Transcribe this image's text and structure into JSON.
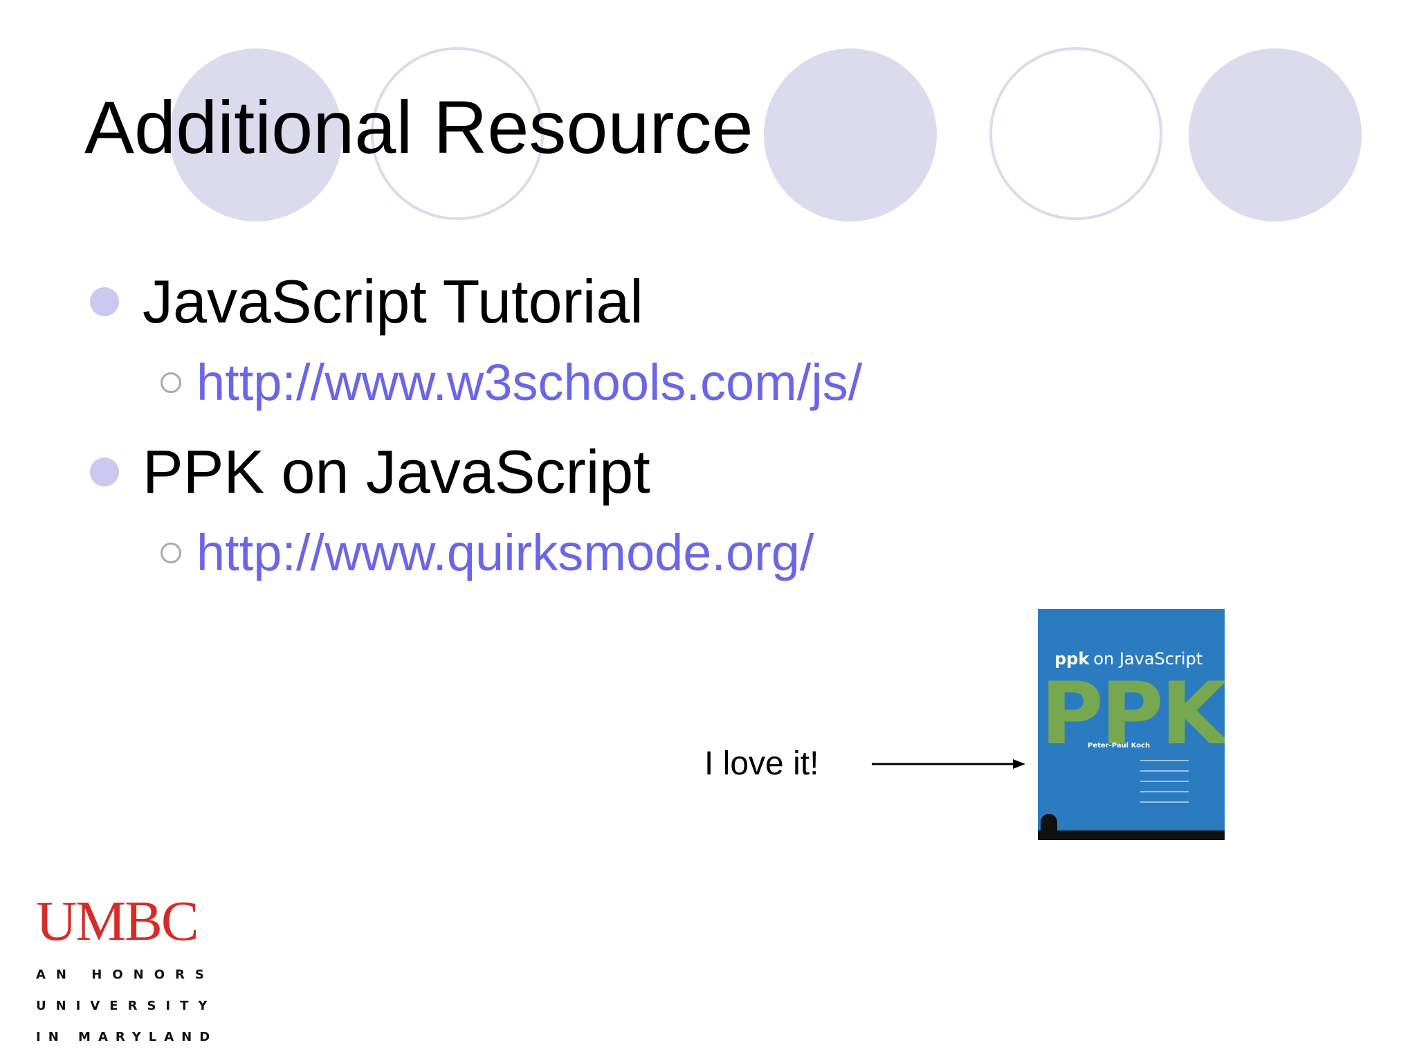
{
  "slide": {
    "title": "Additional Resource",
    "bullets": [
      {
        "text": "JavaScript Tutorial",
        "link": "http://www.w3schools.com/js/"
      },
      {
        "text": "PPK on JavaScript",
        "link": "http://www.quirksmode.org/"
      }
    ],
    "caption": "I love it!"
  },
  "book": {
    "prefix": "ppk",
    "title": "on JavaScript",
    "big_letters": "PPK",
    "author": "Peter-Paul Koch"
  },
  "logo": {
    "word": "UMBC",
    "line1": "AN HONORS",
    "line2": "UNIVERSITY",
    "line3": "IN MARYLAND"
  },
  "colors": {
    "circle_fill": "#dcdaed",
    "bullet_fill": "#cbc9ef",
    "link": "#6b66e6",
    "umbc_red": "#d62b27",
    "book_blue": "#2b7bc1",
    "book_green": "#77a850"
  },
  "icons": {
    "bullet_level1": "filled-circle-bullet-icon",
    "bullet_level2": "hollow-circle-bullet-icon",
    "pointer": "arrow-right-icon"
  }
}
